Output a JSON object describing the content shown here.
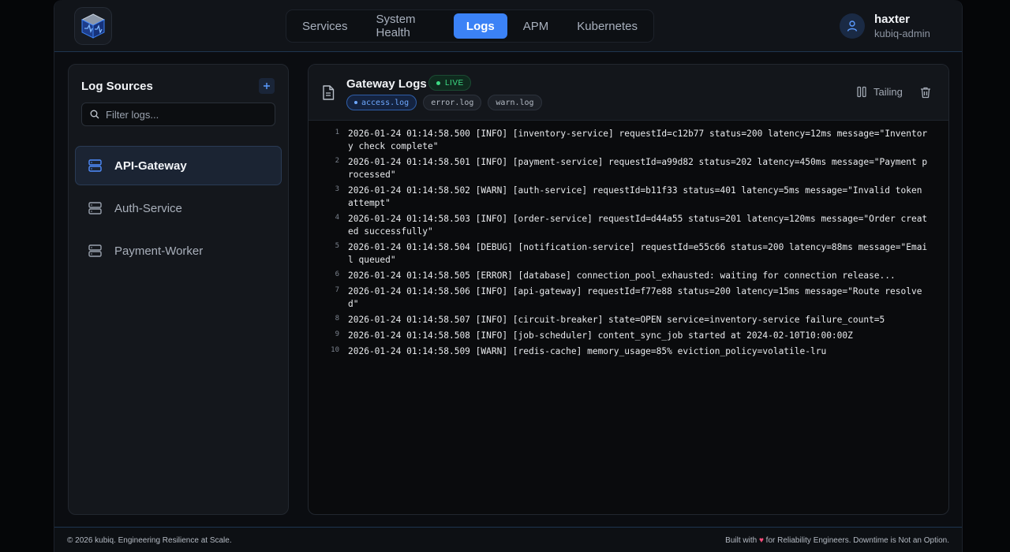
{
  "nav": {
    "tabs": [
      {
        "label": "Services"
      },
      {
        "label": "System Health"
      },
      {
        "label": "Logs"
      },
      {
        "label": "APM"
      },
      {
        "label": "Kubernetes"
      }
    ],
    "active_tab": "Logs"
  },
  "user": {
    "name": "haxter",
    "role": "kubiq-admin"
  },
  "sidebar": {
    "title": "Log Sources",
    "add_label": "+",
    "search_placeholder": "Filter logs...",
    "items": [
      {
        "label": "API-Gateway",
        "active": true
      },
      {
        "label": "Auth-Service",
        "active": false
      },
      {
        "label": "Payment-Worker",
        "active": false
      }
    ]
  },
  "main": {
    "title": "Gateway Logs",
    "live_label": "LIVE",
    "files": [
      {
        "label": "access.log",
        "active": true
      },
      {
        "label": "error.log",
        "active": false
      },
      {
        "label": "warn.log",
        "active": false
      }
    ],
    "tail_label": "Tailing",
    "logs": [
      {
        "n": "1",
        "text": "2026-01-24 01:14:58.500 [INFO] [inventory-service] requestId=c12b77 status=200 latency=12ms message=\"Inventory check complete\""
      },
      {
        "n": "2",
        "text": "2026-01-24 01:14:58.501 [INFO] [payment-service] requestId=a99d82 status=202 latency=450ms message=\"Payment processed\""
      },
      {
        "n": "3",
        "text": "2026-01-24 01:14:58.502 [WARN] [auth-service] requestId=b11f33 status=401 latency=5ms message=\"Invalid token attempt\""
      },
      {
        "n": "4",
        "text": "2026-01-24 01:14:58.503 [INFO] [order-service] requestId=d44a55 status=201 latency=120ms message=\"Order created successfully\""
      },
      {
        "n": "5",
        "text": "2026-01-24 01:14:58.504 [DEBUG] [notification-service] requestId=e55c66 status=200 latency=88ms message=\"Email queued\""
      },
      {
        "n": "6",
        "text": "2026-01-24 01:14:58.505 [ERROR] [database] connection_pool_exhausted: waiting for connection release..."
      },
      {
        "n": "7",
        "text": "2026-01-24 01:14:58.506 [INFO] [api-gateway] requestId=f77e88 status=200 latency=15ms message=\"Route resolved\""
      },
      {
        "n": "8",
        "text": "2026-01-24 01:14:58.507 [INFO] [circuit-breaker] state=OPEN service=inventory-service failure_count=5"
      },
      {
        "n": "9",
        "text": "2026-01-24 01:14:58.508 [INFO] [job-scheduler] content_sync_job started at 2024-02-10T10:00:00Z"
      },
      {
        "n": "10",
        "text": "2026-01-24 01:14:58.509 [WARN] [redis-cache] memory_usage=85% eviction_policy=volatile-lru"
      }
    ]
  },
  "footer": {
    "left": "© 2026 kubiq. Engineering Resilience at Scale.",
    "right_prefix": "Built with",
    "heart": "♥",
    "right_suffix": "for Reliability Engineers. Downtime is Not an Option."
  },
  "colors": {
    "accent": "#3b82f6",
    "live": "#3ddc84",
    "background": "#0b0d11"
  },
  "icons": {
    "logo": "cube-logo-icon",
    "user": "user-icon",
    "search": "search-icon",
    "server": "server-icon",
    "document": "document-icon",
    "pause": "pause-icon",
    "trash": "trash-icon"
  }
}
